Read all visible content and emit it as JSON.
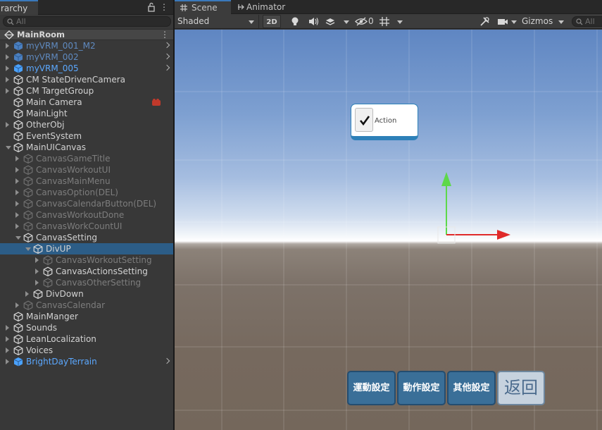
{
  "hierarchy": {
    "tab_label": "rarchy",
    "search_placeholder": "All",
    "scene_name": "MainRoom",
    "menu_glyph": "⋮",
    "items": [
      {
        "label": "myVRM_001_M2",
        "depth": 0,
        "arrow": "right",
        "style": "prefab-dim",
        "icon": "prefab",
        "chevron": true
      },
      {
        "label": "myVRM_002",
        "depth": 0,
        "arrow": "right",
        "style": "prefab-dim",
        "icon": "prefab",
        "chevron": true
      },
      {
        "label": "myVRM_005",
        "depth": 0,
        "arrow": "right",
        "style": "blue",
        "icon": "prefab",
        "chevron": true
      },
      {
        "label": "CM StateDrivenCamera",
        "depth": 0,
        "arrow": "right",
        "style": "normal",
        "icon": "object"
      },
      {
        "label": "CM TargetGroup",
        "depth": 0,
        "arrow": "right",
        "style": "normal",
        "icon": "object"
      },
      {
        "label": "Main Camera",
        "depth": 0,
        "arrow": "none",
        "style": "normal",
        "icon": "object",
        "badge": true
      },
      {
        "label": "MainLight",
        "depth": 0,
        "arrow": "none",
        "style": "normal",
        "icon": "object"
      },
      {
        "label": "OtherObj",
        "depth": 0,
        "arrow": "right",
        "style": "normal",
        "icon": "object"
      },
      {
        "label": "EventSystem",
        "depth": 0,
        "arrow": "none",
        "style": "normal",
        "icon": "object"
      },
      {
        "label": "MainUICanvas",
        "depth": 0,
        "arrow": "down",
        "style": "normal",
        "icon": "object"
      },
      {
        "label": "CanvasGameTitle",
        "depth": 1,
        "arrow": "right",
        "style": "dim",
        "icon": "object"
      },
      {
        "label": "CanvasWorkoutUI",
        "depth": 1,
        "arrow": "right",
        "style": "dim",
        "icon": "object"
      },
      {
        "label": "CanvasMainMenu",
        "depth": 1,
        "arrow": "right",
        "style": "dim",
        "icon": "object"
      },
      {
        "label": "CanvasOption(DEL)",
        "depth": 1,
        "arrow": "right",
        "style": "dim",
        "icon": "object"
      },
      {
        "label": "CanvasCalendarButton(DEL)",
        "depth": 1,
        "arrow": "right",
        "style": "dim",
        "icon": "object"
      },
      {
        "label": "CanvasWorkoutDone",
        "depth": 1,
        "arrow": "right",
        "style": "dim",
        "icon": "object"
      },
      {
        "label": "CanvasWorkCountUI",
        "depth": 1,
        "arrow": "right",
        "style": "dim",
        "icon": "object"
      },
      {
        "label": "CanvasSetting",
        "depth": 1,
        "arrow": "down",
        "style": "normal",
        "icon": "object"
      },
      {
        "label": "DivUP",
        "depth": 2,
        "arrow": "down",
        "style": "normal",
        "icon": "object",
        "selected": true
      },
      {
        "label": "CanvasWorkoutSetting",
        "depth": 3,
        "arrow": "right",
        "style": "dim",
        "icon": "object"
      },
      {
        "label": "CanvasActionsSetting",
        "depth": 3,
        "arrow": "right",
        "style": "normal",
        "icon": "object"
      },
      {
        "label": "CanvasOtherSetting",
        "depth": 3,
        "arrow": "right",
        "style": "dim",
        "icon": "object"
      },
      {
        "label": "DivDown",
        "depth": 2,
        "arrow": "right",
        "style": "normal",
        "icon": "object"
      },
      {
        "label": "CanvasCalendar",
        "depth": 1,
        "arrow": "right",
        "style": "dim",
        "icon": "object"
      },
      {
        "label": "MainManger",
        "depth": 0,
        "arrow": "none",
        "style": "normal",
        "icon": "object"
      },
      {
        "label": "Sounds",
        "depth": 0,
        "arrow": "right",
        "style": "normal",
        "icon": "object"
      },
      {
        "label": "LeanLocalization",
        "depth": 0,
        "arrow": "right",
        "style": "normal",
        "icon": "object"
      },
      {
        "label": "Voices",
        "depth": 0,
        "arrow": "right",
        "style": "normal",
        "icon": "object"
      },
      {
        "label": "BrightDayTerrain",
        "depth": 0,
        "arrow": "right",
        "style": "blue",
        "icon": "prefab",
        "chevron": true
      }
    ]
  },
  "scene": {
    "tabs": {
      "scene": "Scene",
      "animator": "Animator"
    },
    "toolbar": {
      "shading": "Shaded",
      "mode_2d": "2D",
      "hidden_count": "0",
      "gizmos": "Gizmos",
      "search_placeholder": "All"
    },
    "ui": {
      "toggle_label": "Action",
      "buttons": [
        "運動設定",
        "動作設定",
        "其他設定"
      ],
      "back_label": "返回"
    }
  },
  "colors": {
    "selection": "#2c5d87",
    "accent_tab": "#3a79bb",
    "prefab_blue": "#5ba8ff",
    "ui_button": "#3a6f98",
    "gizmo_x": "#e02a2a",
    "gizmo_y": "#5ed84a"
  },
  "icons": {
    "hierarchy_search": "search-icon",
    "lock": "lock-icon",
    "scene_tab": "grid-icon",
    "animator_tab": "animator-icon",
    "lighting": "bulb-icon",
    "audio": "speaker-icon",
    "effects": "layers-icon",
    "visibility": "eye-hidden-icon",
    "grid": "grid-snap-icon",
    "tools": "wrench-icon",
    "camera": "camera-icon"
  }
}
